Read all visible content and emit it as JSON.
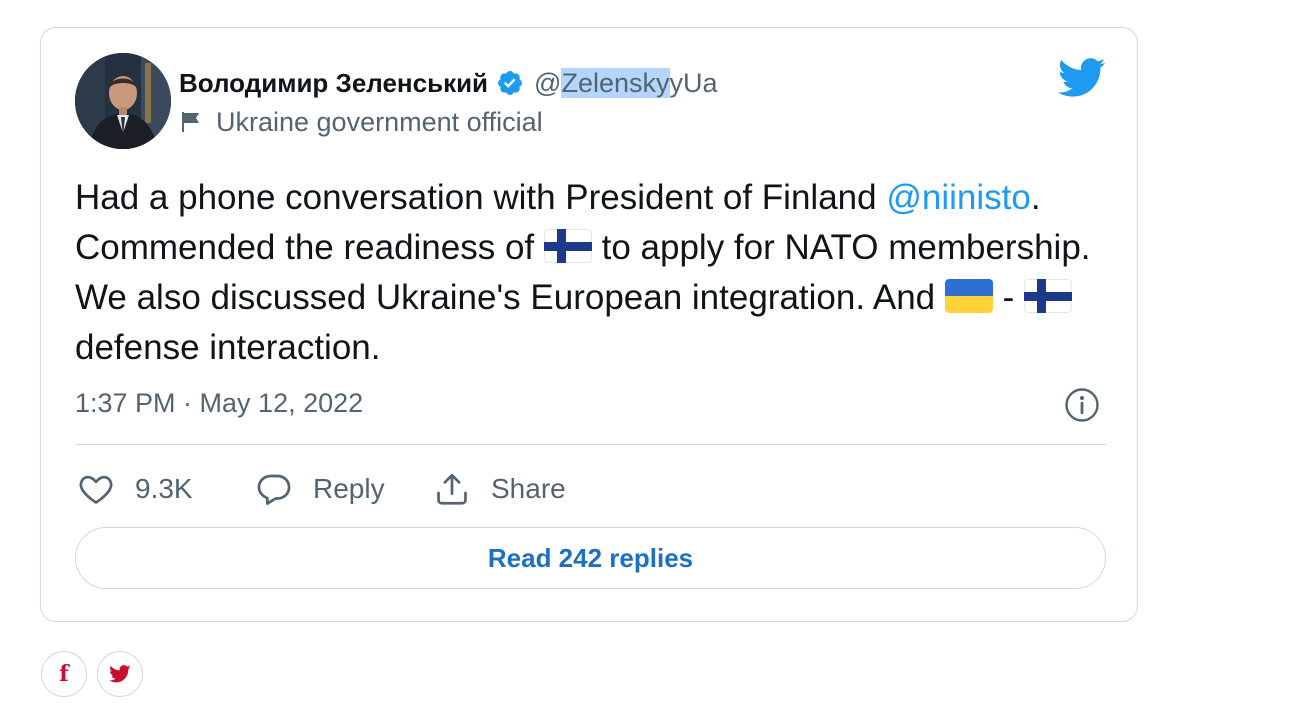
{
  "author": {
    "display_name": "Володимир Зеленський",
    "handle_prefix": "@",
    "handle_highlighted": "Zelensky",
    "handle_rest": "yUa",
    "affiliation": "Ukraine government official"
  },
  "tweet": {
    "text_part1": "Had a phone conversation with President of Finland ",
    "mention": "@niinisto",
    "text_part2": ". Commended the readiness of ",
    "text_part3": " to apply for NATO membership. We also discussed Ukraine's European integration. And ",
    "text_part4": " - ",
    "text_part5": " defense interaction.",
    "timestamp": "1:37 PM · May 12, 2022"
  },
  "actions": {
    "like_count": "9.3K",
    "reply_label": "Reply",
    "share_label": "Share"
  },
  "read_replies_label": "Read 242 replies",
  "share_buttons": {
    "facebook_glyph": "f"
  },
  "colors": {
    "twitter_blue": "#1d9bf0",
    "link_blue": "#1d6fc4",
    "social_red": "#c8102e"
  },
  "icons": [
    "verified-badge-icon",
    "government-flag-icon",
    "twitter-bird-icon",
    "info-icon",
    "heart-icon",
    "reply-bubble-icon",
    "share-icon",
    "facebook-icon",
    "twitter-share-icon"
  ]
}
